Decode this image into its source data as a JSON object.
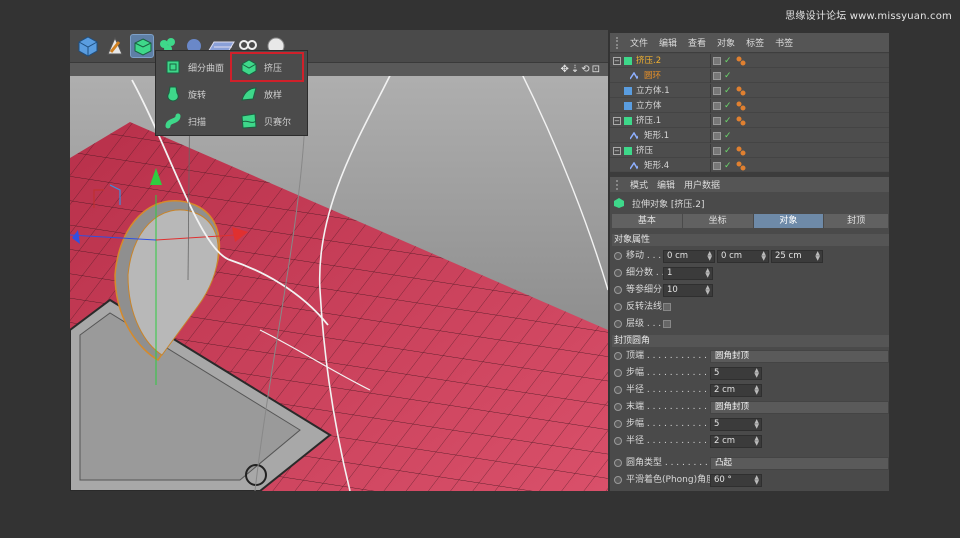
{
  "watermark": "思缘设计论坛 www.missyuan.com",
  "popup": {
    "items": [
      {
        "label": "细分曲面",
        "icon": "subdivision-surface-icon"
      },
      {
        "label": "挤压",
        "icon": "extrude-icon"
      },
      {
        "label": "旋转",
        "icon": "lathe-icon"
      },
      {
        "label": "放样",
        "icon": "loft-icon"
      },
      {
        "label": "扫描",
        "icon": "sweep-icon"
      },
      {
        "label": "贝赛尔",
        "icon": "bezier-icon"
      }
    ]
  },
  "object_manager": {
    "menu": [
      "文件",
      "编辑",
      "查看",
      "对象",
      "标签",
      "书签"
    ],
    "rows": [
      {
        "name": "挤压.2",
        "icon": "extrude-icon"
      },
      {
        "name": "圆环",
        "icon": "spline-icon"
      },
      {
        "name": "立方体.1",
        "icon": "cube-icon"
      },
      {
        "name": "立方体",
        "icon": "cube-icon"
      },
      {
        "name": "挤压.1",
        "icon": "extrude-icon"
      },
      {
        "name": "矩形.1",
        "icon": "spline-icon"
      },
      {
        "name": "挤压",
        "icon": "extrude-icon"
      },
      {
        "name": "矩形.4",
        "icon": "spline-icon"
      }
    ]
  },
  "attributes": {
    "menu": [
      "模式",
      "编辑",
      "用户数据"
    ],
    "title": "拉伸对象 [挤压.2]",
    "tabs": [
      "基本",
      "坐标",
      "对象",
      "封顶"
    ],
    "section_object": "对象属性",
    "move_label": "移动 . . .",
    "move_x": "0 cm",
    "move_y": "0 cm",
    "move_z": "25 cm",
    "subdiv_label": "细分数 . .",
    "subdiv_value": "1",
    "iso_label": "等参细分",
    "iso_value": "10",
    "flip_label": "反转法线",
    "hier_label": "层级 . . .",
    "section_caps": "封顶圆角",
    "start_label": "顶端 . . . . . . . . . . . . .",
    "start_value": "圆角封顶",
    "steps1_label": "步幅 . . . . . . . . . . . . .",
    "steps1_value": "5",
    "radius1_label": "半径 . . . . . . . . . . . . .",
    "radius1_value": "2 cm",
    "end_label": "末端 . . . . . . . . . . . . .",
    "end_value": "圆角封顶",
    "steps2_label": "步幅 . . . . . . . . . . . . .",
    "steps2_value": "5",
    "radius2_label": "半径 . . . . . . . . . . . . .",
    "radius2_value": "2 cm",
    "fillet_label": "圆角类型 . . . . . . . . . .",
    "fillet_value": "凸起",
    "phong_label": "平滑着色(Phong)角度",
    "phong_value": "60 °"
  },
  "colors": {
    "floor": "#d4455c",
    "highlight": "#d0202a",
    "active_tab": "#6e8aa8",
    "selected_text": "#f0b030"
  }
}
